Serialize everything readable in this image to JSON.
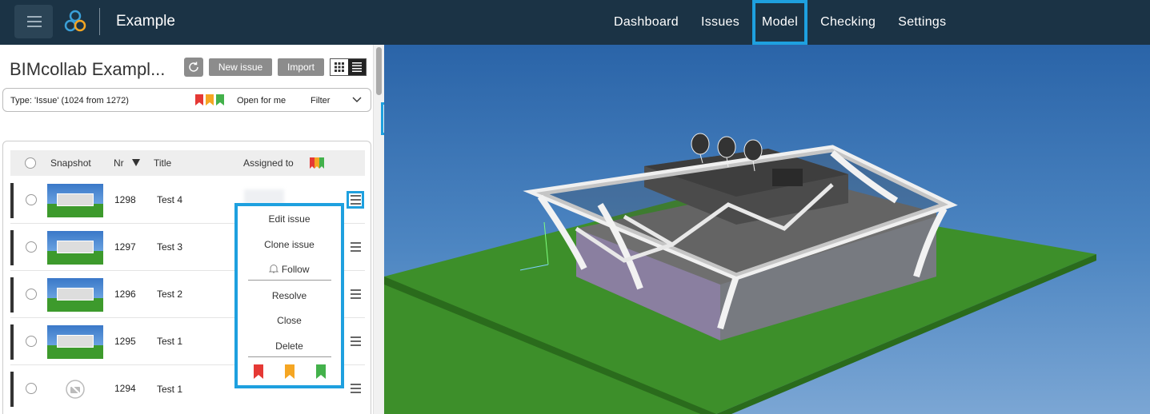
{
  "header": {
    "app_title": "Example",
    "nav": [
      {
        "label": "Dashboard"
      },
      {
        "label": "Issues"
      },
      {
        "label": "Model"
      },
      {
        "label": "Checking"
      },
      {
        "label": "Settings"
      }
    ],
    "active_nav": "Model"
  },
  "panel": {
    "title": "BIMcollab Exampl...",
    "new_issue_label": "New issue",
    "import_label": "Import"
  },
  "filter": {
    "type_text": "Type: 'Issue' (1024 from 1272)",
    "open_for_me": "Open for me",
    "filter_label": "Filter"
  },
  "table": {
    "columns": {
      "snapshot": "Snapshot",
      "nr": "Nr",
      "title": "Title",
      "assigned": "Assigned to"
    },
    "rows": [
      {
        "nr": "1298",
        "title": "Test 4"
      },
      {
        "nr": "1297",
        "title": "Test 3"
      },
      {
        "nr": "1296",
        "title": "Test 2"
      },
      {
        "nr": "1295",
        "title": "Test 1"
      },
      {
        "nr": "1294",
        "title": "Test 1"
      }
    ]
  },
  "context_menu": {
    "edit": "Edit issue",
    "clone": "Clone issue",
    "follow": "Follow",
    "resolve": "Resolve",
    "close": "Close",
    "delete": "Delete"
  },
  "colors": {
    "header_bg": "#1b3345",
    "highlight": "#1ea0df",
    "flag_red": "#e53935",
    "flag_orange": "#f5a623",
    "flag_green": "#43b14b",
    "ground": "#3d8f2a"
  },
  "icons": [
    "menu-icon",
    "bimcollab-logo-icon",
    "refresh-icon",
    "grid-view-icon",
    "list-view-icon",
    "chevron-down-icon",
    "sort-down-icon",
    "flag-icon",
    "bell-icon",
    "chevron-left-icon",
    "no-snapshot-icon"
  ]
}
